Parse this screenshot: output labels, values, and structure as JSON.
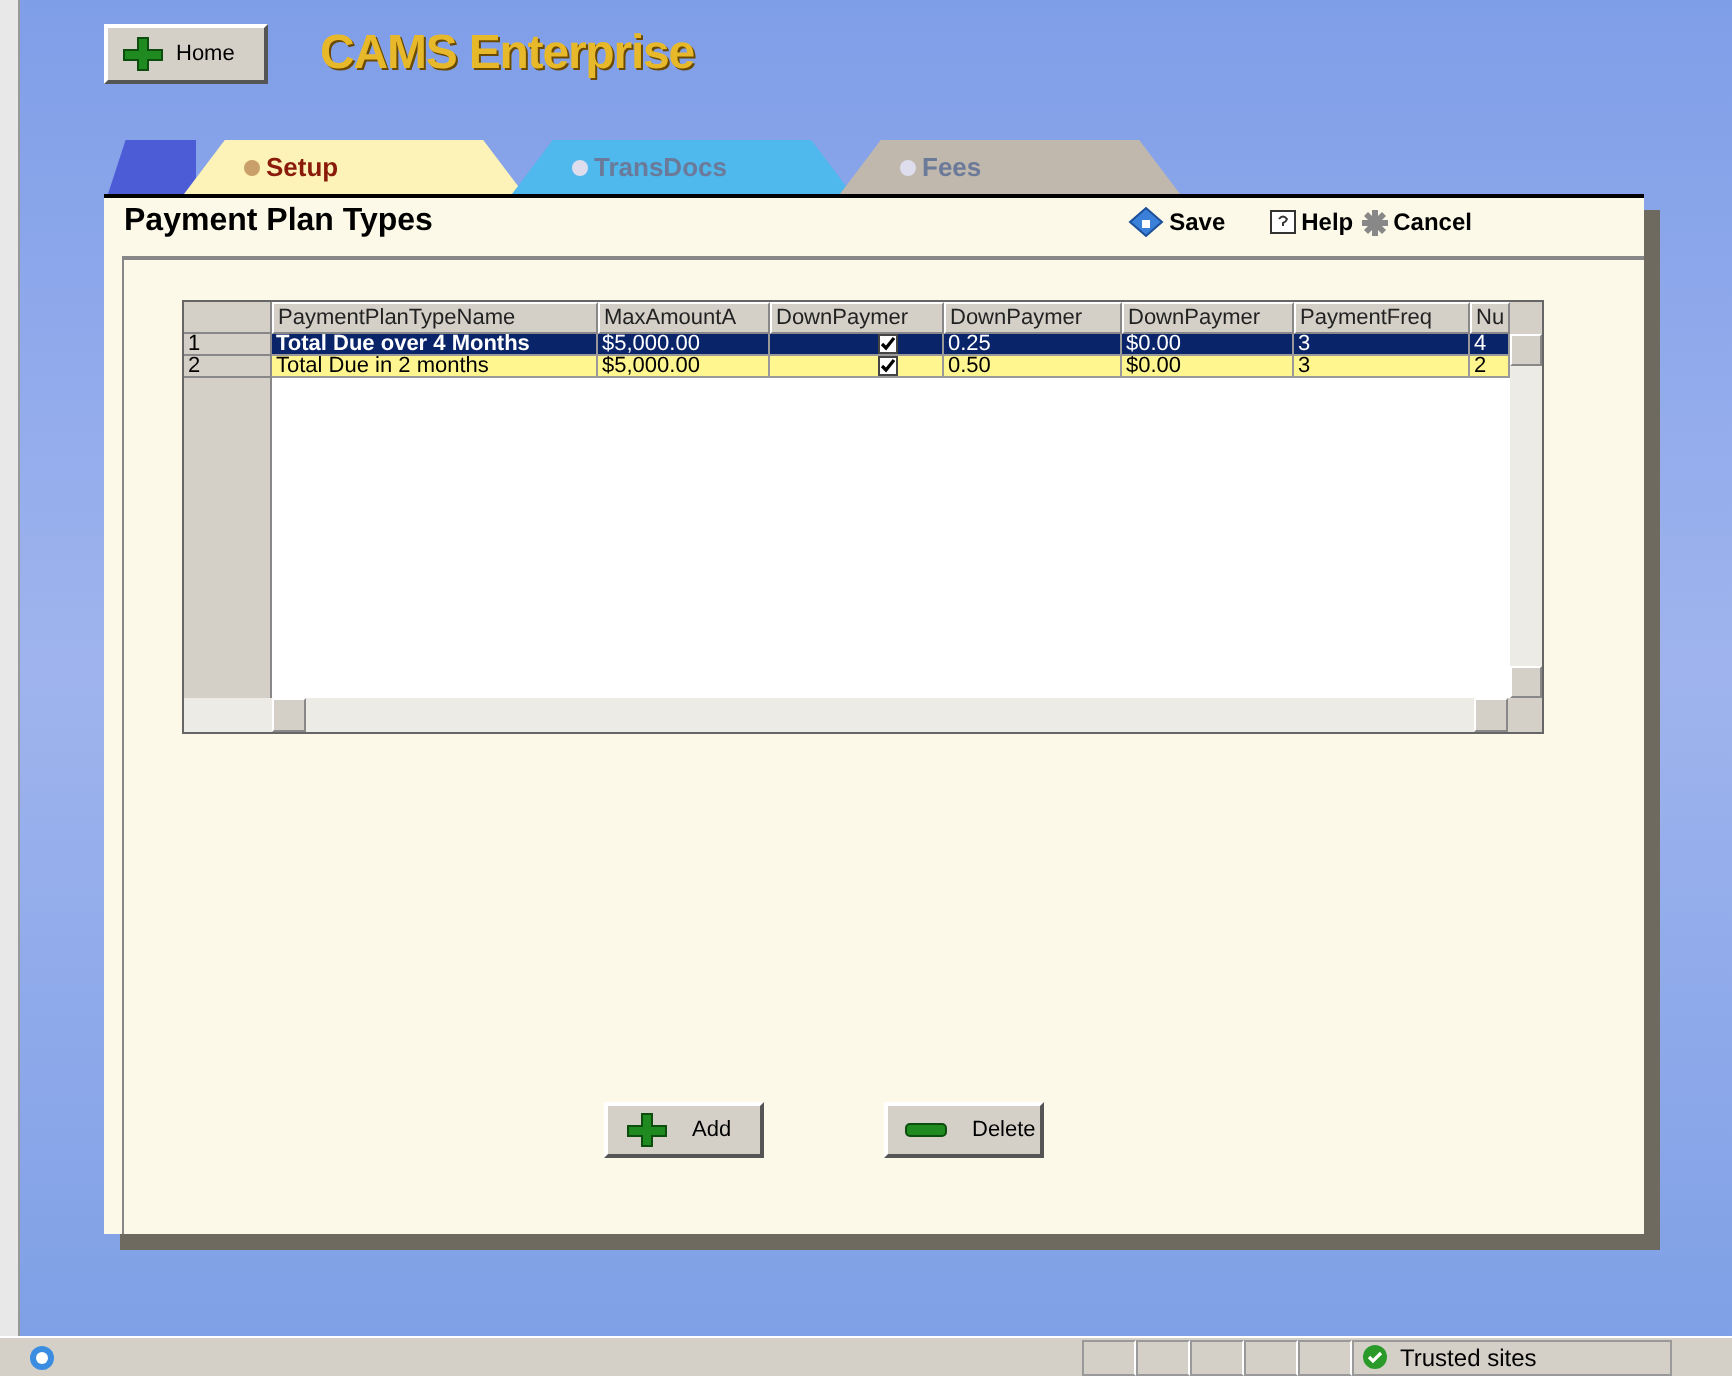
{
  "header": {
    "home_button": "Home",
    "app_title": "CAMS Enterprise"
  },
  "tabs": [
    {
      "label": "Setup",
      "selected": true,
      "color": "#fdf3b8"
    },
    {
      "label": "TransDocs",
      "selected": false,
      "color": "#4fb8ec"
    },
    {
      "label": "Fees",
      "selected": false,
      "color": "#c0b8ad"
    }
  ],
  "page_title": "Payment Plan Types",
  "toolbar": [
    {
      "kind": "save",
      "label": "Save"
    },
    {
      "kind": "help",
      "label": "Help"
    },
    {
      "kind": "cancel",
      "label": "Cancel"
    }
  ],
  "table": {
    "columns": [
      "PaymentPlanTypeName",
      "MaxAmountA",
      "DownPaymer",
      "DownPaymer",
      "DownPaymer",
      "PaymentFreq",
      "Nu"
    ],
    "rows": [
      {
        "number": "1",
        "selected": true,
        "cells": [
          {
            "kind": "text",
            "text": "Total Due over 4 Months"
          },
          {
            "kind": "text",
            "text": "$5,000.00"
          },
          {
            "kind": "checkbox",
            "checked": true
          },
          {
            "kind": "text",
            "text": "0.25"
          },
          {
            "kind": "text",
            "text": "$0.00"
          },
          {
            "kind": "text",
            "text": "3"
          },
          {
            "kind": "text",
            "text": "4"
          }
        ]
      },
      {
        "number": "2",
        "selected": false,
        "cells": [
          {
            "kind": "text",
            "text": "Total Due in 2 months"
          },
          {
            "kind": "text",
            "text": "$5,000.00"
          },
          {
            "kind": "checkbox",
            "checked": true
          },
          {
            "kind": "text",
            "text": "0.50"
          },
          {
            "kind": "text",
            "text": "$0.00"
          },
          {
            "kind": "text",
            "text": "3"
          },
          {
            "kind": "text",
            "text": "2"
          }
        ]
      }
    ]
  },
  "buttons": [
    {
      "kind": "add",
      "label": "Add"
    },
    {
      "kind": "delete",
      "label": "Delete"
    }
  ],
  "status_bar": {
    "zone": "Trusted sites"
  }
}
